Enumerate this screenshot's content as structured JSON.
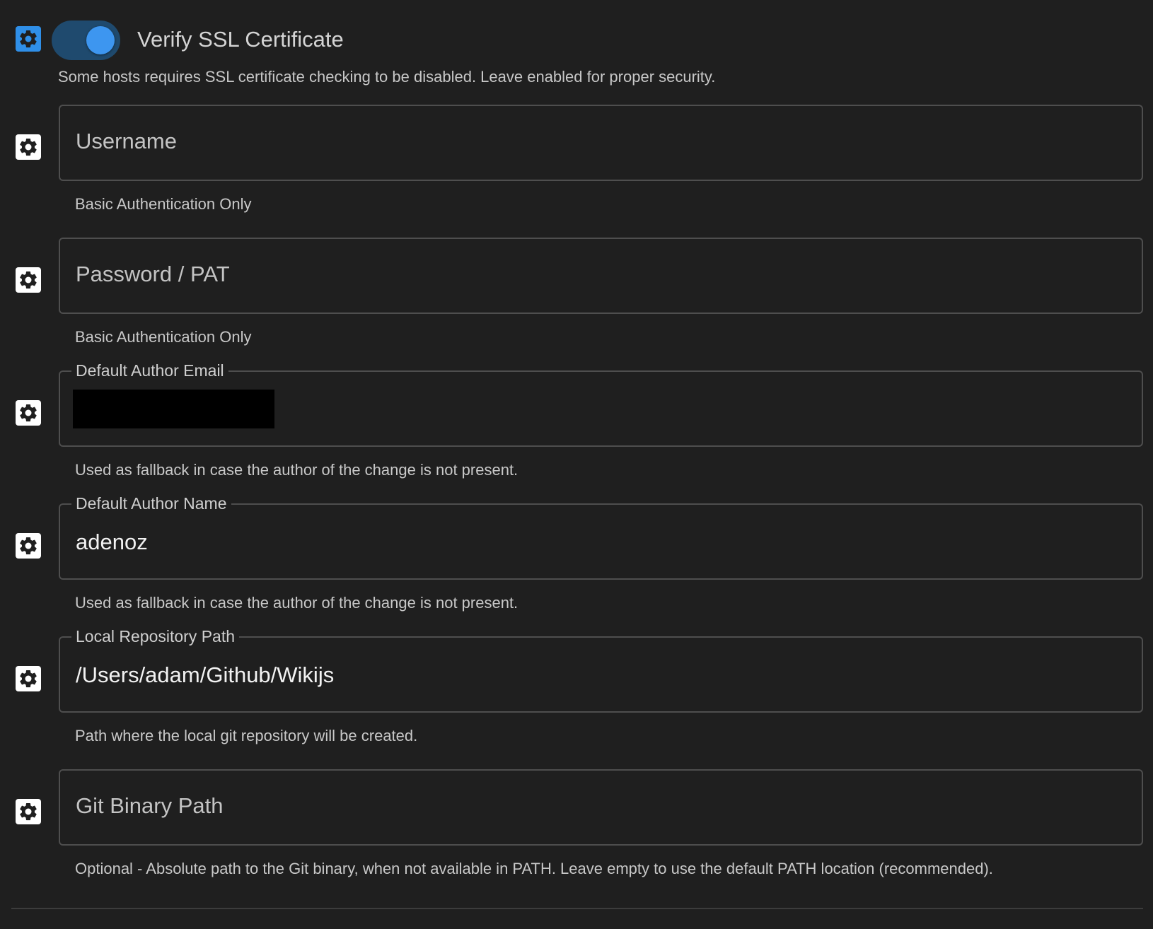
{
  "verify_ssl": {
    "label": "Verify SSL Certificate",
    "enabled": true,
    "hint": "Some hosts requires SSL certificate checking to be disabled. Leave enabled for proper security."
  },
  "fields": {
    "username": {
      "placeholder": "Username",
      "hint": "Basic Authentication Only"
    },
    "password": {
      "placeholder": "Password / PAT",
      "hint": "Basic Authentication Only"
    },
    "author_email": {
      "label": "Default Author Email",
      "hint": "Used as fallback in case the author of the change is not present."
    },
    "author_name": {
      "label": "Default Author Name",
      "value": "adenoz",
      "hint": "Used as fallback in case the author of the change is not present."
    },
    "repo_path": {
      "label": "Local Repository Path",
      "value": "/Users/adam/Github/Wikijs",
      "hint": "Path where the local git repository will be created."
    },
    "git_binary": {
      "placeholder": "Git Binary Path",
      "hint": "Optional - Absolute path to the Git binary, when not available in PATH. Leave empty to use the default PATH location (recommended)."
    }
  },
  "icons": {
    "config_toggle": "gear-icon",
    "accent_color": "#2f8fe8"
  }
}
